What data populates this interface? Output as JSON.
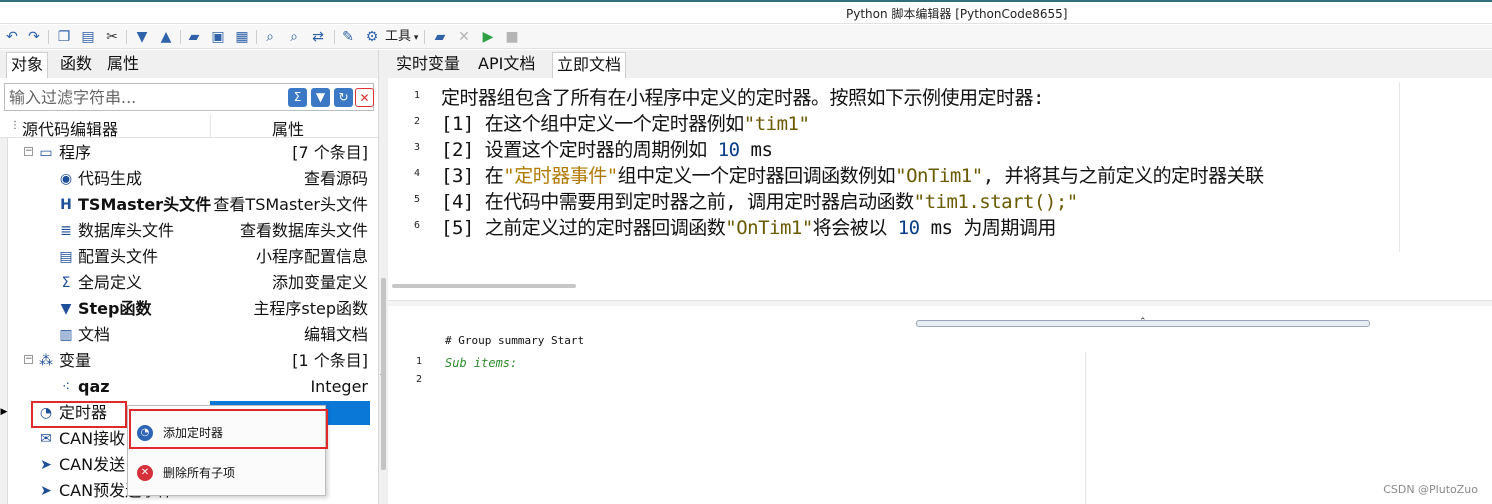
{
  "window": {
    "title": "Python 脚本编辑器 [PythonCode8655]"
  },
  "toolbar": {
    "tools_label": "工具",
    "icons": [
      "undo-icon",
      "redo-icon",
      "copy-icon",
      "paste-icon",
      "cut-icon",
      "move-down-icon",
      "move-up-icon",
      "open-icon",
      "save-icon",
      "save-all-icon",
      "find-icon",
      "find-next-icon",
      "replace-icon",
      "edit-icon",
      "gear-icon",
      "folder-icon",
      "clear-icon",
      "run-icon",
      "stop-icon"
    ]
  },
  "left_tabs": [
    "对象",
    "函数",
    "属性"
  ],
  "filter": {
    "placeholder": "输入过滤字符串..."
  },
  "tree_header": {
    "col1": "源代码编辑器",
    "col2": "属性"
  },
  "tree": [
    {
      "name": "程序",
      "value": "[7 个条目]"
    },
    {
      "name": "代码生成",
      "value": "查看源码"
    },
    {
      "name": "TSMaster头文件",
      "value": "查看TSMaster头文件"
    },
    {
      "name": "数据库头文件",
      "value": "查看数据库头文件"
    },
    {
      "name": "配置头文件",
      "value": "小程序配置信息"
    },
    {
      "name": "全局定义",
      "value": "添加变量定义"
    },
    {
      "name": "Step函数",
      "value": "主程序step函数"
    },
    {
      "name": "文档",
      "value": "编辑文档"
    },
    {
      "name": "变量",
      "value": "[1 个条目]"
    },
    {
      "name": "qaz",
      "value": "Integer"
    },
    {
      "name": "定时器",
      "value": ""
    },
    {
      "name": "CAN接收",
      "value": ""
    },
    {
      "name": "CAN发送",
      "value": ""
    },
    {
      "name": "CAN预发送事件",
      "value": ""
    }
  ],
  "context_menu": [
    {
      "label": "添加定时器"
    },
    {
      "label": "删除所有子项"
    }
  ],
  "right_tabs": [
    "实时变量",
    "API文档",
    "立即文档"
  ],
  "doc": {
    "line_numbers": [
      "1",
      "2",
      "3",
      "4",
      "5",
      "6"
    ],
    "l1": "定时器组包含了所有在小程序中定义的定时器。按照如下示例使用定时器:",
    "l2a": "[1] 在这个组中定义一个定时器例如",
    "l2b": "\"tim1\"",
    "l3a": "[2] 设置这个定时器的周期例如 ",
    "l3b": "10",
    "l3c": " ms",
    "l4a": "[3] 在",
    "l4b": "\"定时器事件\"",
    "l4c": "组中定义一个定时器回调函数例如",
    "l4d": "\"OnTim1\"",
    "l4e": ", 并将其与之前定义的定时器关联",
    "l5a": "[4] 在代码中需要用到定时器之前, 调用定时器启动函数",
    "l5b": "\"tim1.start();\"",
    "l6a": "[5] 之前定义过的定时器回调函数",
    "l6b": "\"OnTim1\"",
    "l6c": "将会被以 ",
    "l6d": "10",
    "l6e": " ms 为周期调用"
  },
  "editor": {
    "header": "# Group summary Start",
    "line_numbers": [
      "1",
      "2"
    ],
    "code": "Sub items:"
  },
  "watermark": "CSDN @PlutoZuo"
}
